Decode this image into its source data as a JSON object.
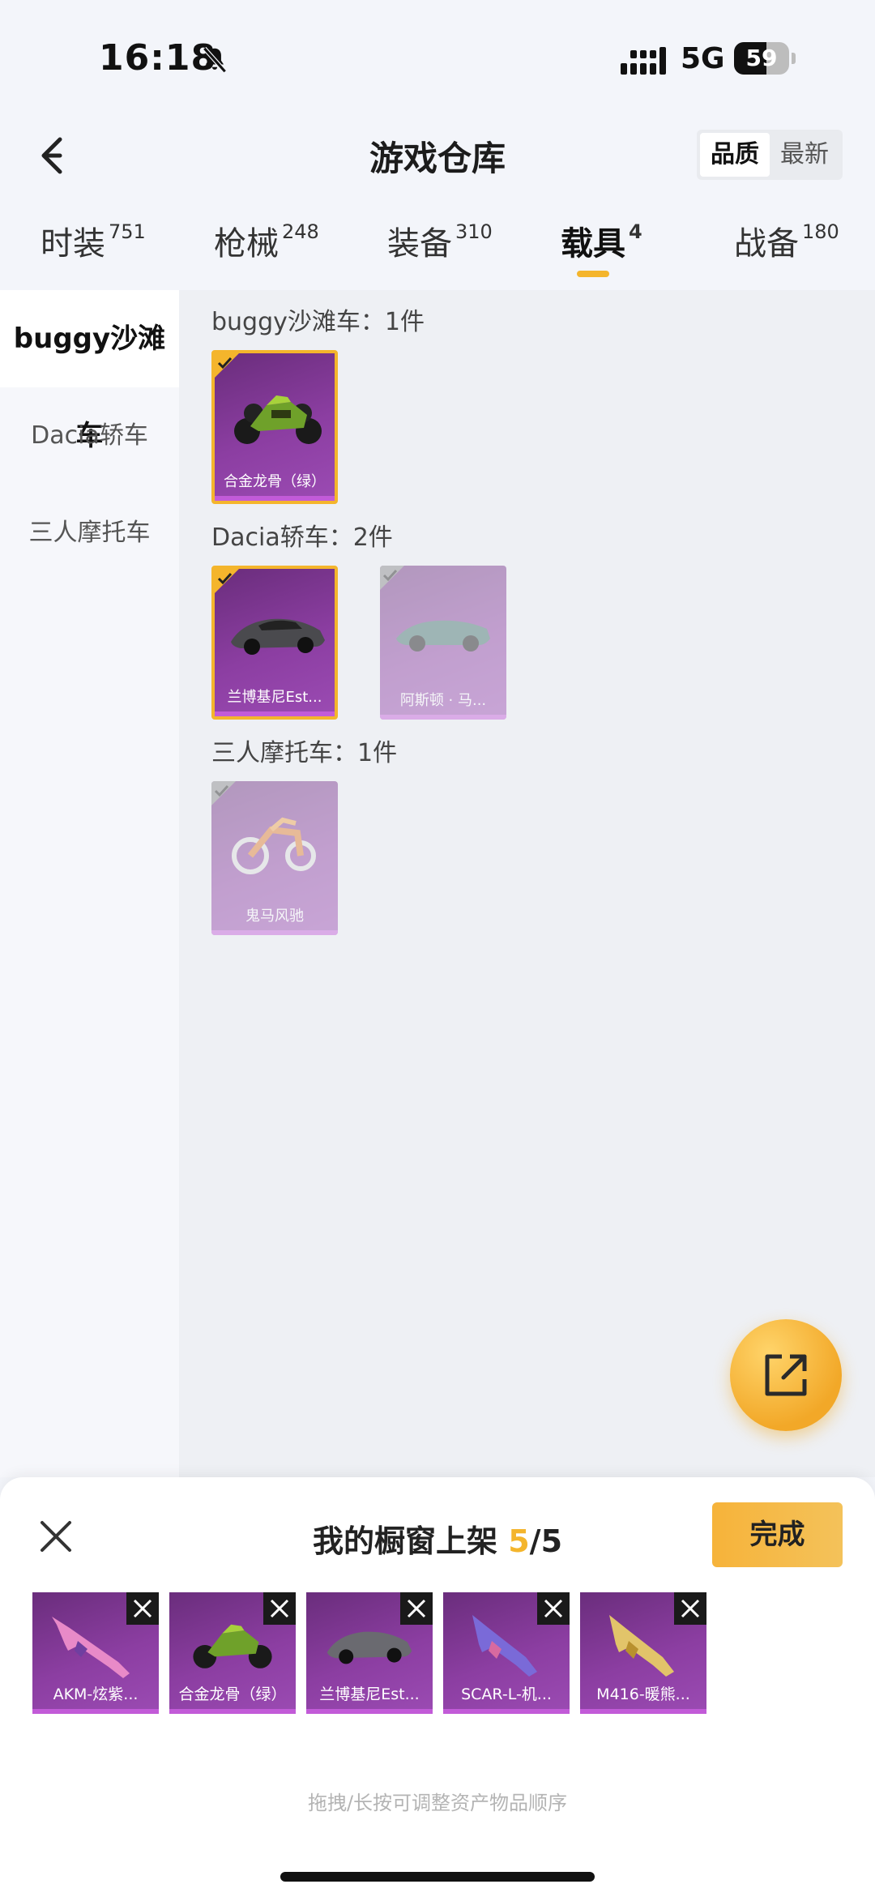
{
  "status_bar": {
    "time": "16:18",
    "network": "5G",
    "battery": "59",
    "battery_level": 0.59
  },
  "header": {
    "title": "游戏仓库",
    "sort_options": [
      "品质",
      "最新"
    ],
    "sort_selected": "品质"
  },
  "tabs": [
    {
      "label": "时装",
      "count": "751"
    },
    {
      "label": "枪械",
      "count": "248"
    },
    {
      "label": "装备",
      "count": "310"
    },
    {
      "label": "载具",
      "count": "4",
      "active": true
    },
    {
      "label": "战备",
      "count": "180"
    }
  ],
  "sidebar": {
    "items": [
      {
        "label": "buggy沙滩车",
        "active": true
      },
      {
        "label": "Dacia轿车"
      },
      {
        "label": "三人摩托车"
      }
    ]
  },
  "groups": [
    {
      "title": "buggy沙滩车：1件",
      "items": [
        {
          "label": "合金龙骨（绿）",
          "selected": true,
          "icon": "buggy-vehicle-image"
        }
      ]
    },
    {
      "title": "Dacia轿车：2件",
      "items": [
        {
          "label": "兰博基尼Est...",
          "selected": true,
          "icon": "sports-car-image"
        },
        {
          "label": "阿斯顿 · 马...",
          "selected": false,
          "icon": "convertible-car-image"
        }
      ]
    },
    {
      "title": "三人摩托车：1件",
      "items": [
        {
          "label": "鬼马风驰",
          "selected": false,
          "icon": "motorcycle-image"
        }
      ]
    }
  ],
  "sheet": {
    "title": "我的橱窗上架",
    "count": "5",
    "total": "5",
    "separator": "/",
    "done_label": "完成",
    "items": [
      {
        "label": "AKM-炫紫...",
        "icon": "rifle-image"
      },
      {
        "label": "合金龙骨（绿）",
        "icon": "buggy-vehicle-image"
      },
      {
        "label": "兰博基尼Est...",
        "icon": "sports-car-image"
      },
      {
        "label": "SCAR-L-机...",
        "icon": "rifle-image"
      },
      {
        "label": "M416-暖熊...",
        "icon": "rifle-image"
      }
    ],
    "hint": "拖拽/长按可调整资产物品顺序"
  },
  "colors": {
    "accent": "#f4b52c",
    "card_purple": "#8c3ea2",
    "background": "#f3f5fa"
  }
}
